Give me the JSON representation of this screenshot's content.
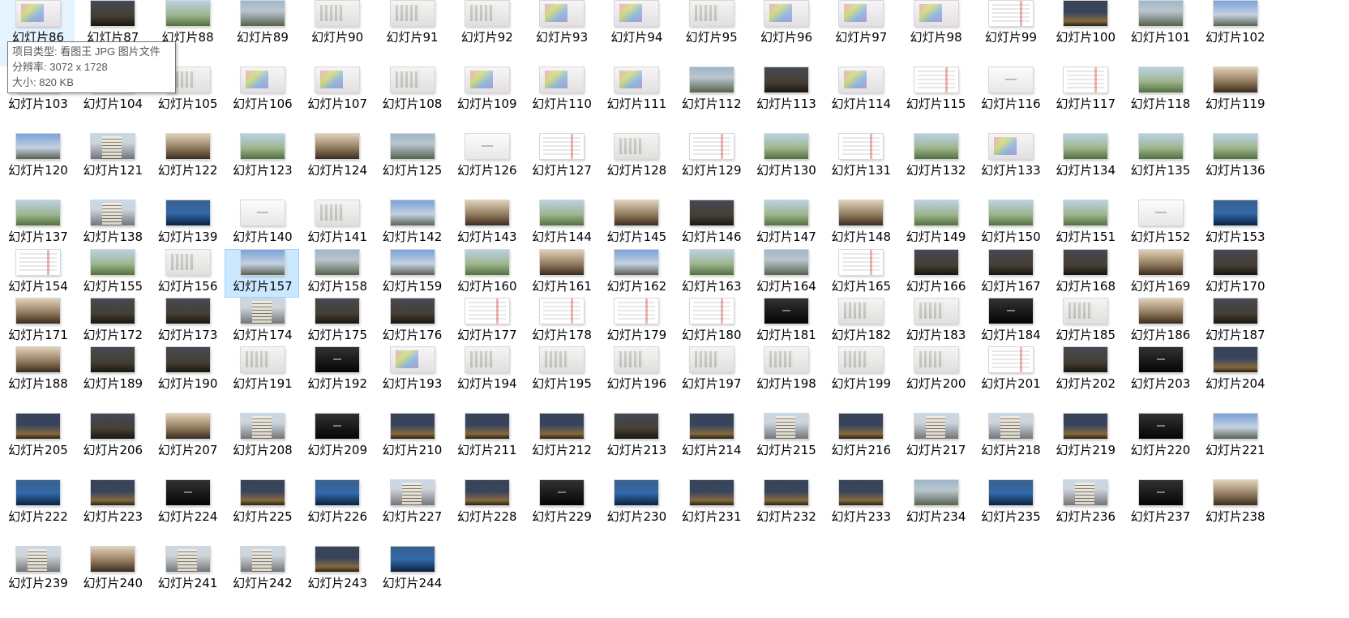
{
  "files": [
    {
      "label": "幻灯片86",
      "thumb": "color",
      "selected": false,
      "hovered": true
    },
    {
      "label": "幻灯片87",
      "thumb": "dark"
    },
    {
      "label": "幻灯片88",
      "thumb": "green"
    },
    {
      "label": "幻灯片89",
      "thumb": "photo"
    },
    {
      "label": "幻灯片90",
      "thumb": "plan"
    },
    {
      "label": "幻灯片91",
      "thumb": "plan"
    },
    {
      "label": "幻灯片92",
      "thumb": "plan"
    },
    {
      "label": "幻灯片93",
      "thumb": "color"
    },
    {
      "label": "幻灯片94",
      "thumb": "color"
    },
    {
      "label": "幻灯片95",
      "thumb": "plan"
    },
    {
      "label": "幻灯片96",
      "thumb": "color"
    },
    {
      "label": "幻灯片97",
      "thumb": "color"
    },
    {
      "label": "幻灯片98",
      "thumb": "color"
    },
    {
      "label": "幻灯片99",
      "thumb": "doc"
    },
    {
      "label": "幻灯片100",
      "thumb": "night"
    },
    {
      "label": "幻灯片101",
      "thumb": "photo"
    },
    {
      "label": "幻灯片102",
      "thumb": "sky"
    },
    {
      "label": "幻灯片103",
      "thumb": "plan"
    },
    {
      "label": "幻灯片104",
      "thumb": "plan"
    },
    {
      "label": "幻灯片105",
      "thumb": "plan"
    },
    {
      "label": "幻灯片106",
      "thumb": "color"
    },
    {
      "label": "幻灯片107",
      "thumb": "color"
    },
    {
      "label": "幻灯片108",
      "thumb": "plan"
    },
    {
      "label": "幻灯片109",
      "thumb": "color"
    },
    {
      "label": "幻灯片110",
      "thumb": "color"
    },
    {
      "label": "幻灯片111",
      "thumb": "color"
    },
    {
      "label": "幻灯片112",
      "thumb": "photo"
    },
    {
      "label": "幻灯片113",
      "thumb": "dark"
    },
    {
      "label": "幻灯片114",
      "thumb": "color"
    },
    {
      "label": "幻灯片115",
      "thumb": "doc"
    },
    {
      "label": "幻灯片116",
      "thumb": "white"
    },
    {
      "label": "幻灯片117",
      "thumb": "doc"
    },
    {
      "label": "幻灯片118",
      "thumb": "green"
    },
    {
      "label": "幻灯片119",
      "thumb": "interior"
    },
    {
      "label": "幻灯片120",
      "thumb": "sky"
    },
    {
      "label": "幻灯片121",
      "thumb": "bld"
    },
    {
      "label": "幻灯片122",
      "thumb": "interior"
    },
    {
      "label": "幻灯片123",
      "thumb": "green"
    },
    {
      "label": "幻灯片124",
      "thumb": "interior"
    },
    {
      "label": "幻灯片125",
      "thumb": "photo"
    },
    {
      "label": "幻灯片126",
      "thumb": "white"
    },
    {
      "label": "幻灯片127",
      "thumb": "doc"
    },
    {
      "label": "幻灯片128",
      "thumb": "plan"
    },
    {
      "label": "幻灯片129",
      "thumb": "doc"
    },
    {
      "label": "幻灯片130",
      "thumb": "green"
    },
    {
      "label": "幻灯片131",
      "thumb": "doc"
    },
    {
      "label": "幻灯片132",
      "thumb": "green"
    },
    {
      "label": "幻灯片133",
      "thumb": "color"
    },
    {
      "label": "幻灯片134",
      "thumb": "green"
    },
    {
      "label": "幻灯片135",
      "thumb": "green"
    },
    {
      "label": "幻灯片136",
      "thumb": "green"
    },
    {
      "label": "幻灯片137",
      "thumb": "green"
    },
    {
      "label": "幻灯片138",
      "thumb": "bld"
    },
    {
      "label": "幻灯片139",
      "thumb": "blue"
    },
    {
      "label": "幻灯片140",
      "thumb": "white"
    },
    {
      "label": "幻灯片141",
      "thumb": "plan"
    },
    {
      "label": "幻灯片142",
      "thumb": "sky"
    },
    {
      "label": "幻灯片143",
      "thumb": "interior"
    },
    {
      "label": "幻灯片144",
      "thumb": "green"
    },
    {
      "label": "幻灯片145",
      "thumb": "interior"
    },
    {
      "label": "幻灯片146",
      "thumb": "dark"
    },
    {
      "label": "幻灯片147",
      "thumb": "green"
    },
    {
      "label": "幻灯片148",
      "thumb": "interior"
    },
    {
      "label": "幻灯片149",
      "thumb": "green"
    },
    {
      "label": "幻灯片150",
      "thumb": "green"
    },
    {
      "label": "幻灯片151",
      "thumb": "green"
    },
    {
      "label": "幻灯片152",
      "thumb": "white"
    },
    {
      "label": "幻灯片153",
      "thumb": "blue"
    },
    {
      "label": "幻灯片154",
      "thumb": "doc"
    },
    {
      "label": "幻灯片155",
      "thumb": "green"
    },
    {
      "label": "幻灯片156",
      "thumb": "plan"
    },
    {
      "label": "幻灯片157",
      "thumb": "sky",
      "selected": true
    },
    {
      "label": "幻灯片158",
      "thumb": "photo"
    },
    {
      "label": "幻灯片159",
      "thumb": "sky"
    },
    {
      "label": "幻灯片160",
      "thumb": "green"
    },
    {
      "label": "幻灯片161",
      "thumb": "interior"
    },
    {
      "label": "幻灯片162",
      "thumb": "sky"
    },
    {
      "label": "幻灯片163",
      "thumb": "green"
    },
    {
      "label": "幻灯片164",
      "thumb": "photo"
    },
    {
      "label": "幻灯片165",
      "thumb": "doc"
    },
    {
      "label": "幻灯片166",
      "thumb": "dark"
    },
    {
      "label": "幻灯片167",
      "thumb": "dark"
    },
    {
      "label": "幻灯片168",
      "thumb": "dark"
    },
    {
      "label": "幻灯片169",
      "thumb": "interior"
    },
    {
      "label": "幻灯片170",
      "thumb": "dark"
    },
    {
      "label": "幻灯片171",
      "thumb": "interior"
    },
    {
      "label": "幻灯片172",
      "thumb": "dark"
    },
    {
      "label": "幻灯片173",
      "thumb": "dark"
    },
    {
      "label": "幻灯片174",
      "thumb": "bld"
    },
    {
      "label": "幻灯片175",
      "thumb": "dark"
    },
    {
      "label": "幻灯片176",
      "thumb": "dark"
    },
    {
      "label": "幻灯片177",
      "thumb": "doc"
    },
    {
      "label": "幻灯片178",
      "thumb": "doc"
    },
    {
      "label": "幻灯片179",
      "thumb": "doc"
    },
    {
      "label": "幻灯片180",
      "thumb": "doc"
    },
    {
      "label": "幻灯片181",
      "thumb": "black"
    },
    {
      "label": "幻灯片182",
      "thumb": "plan"
    },
    {
      "label": "幻灯片183",
      "thumb": "plan"
    },
    {
      "label": "幻灯片184",
      "thumb": "black"
    },
    {
      "label": "幻灯片185",
      "thumb": "plan"
    },
    {
      "label": "幻灯片186",
      "thumb": "interior"
    },
    {
      "label": "幻灯片187",
      "thumb": "dark"
    },
    {
      "label": "幻灯片188",
      "thumb": "interior"
    },
    {
      "label": "幻灯片189",
      "thumb": "dark"
    },
    {
      "label": "幻灯片190",
      "thumb": "dark"
    },
    {
      "label": "幻灯片191",
      "thumb": "plan"
    },
    {
      "label": "幻灯片192",
      "thumb": "black"
    },
    {
      "label": "幻灯片193",
      "thumb": "color"
    },
    {
      "label": "幻灯片194",
      "thumb": "plan"
    },
    {
      "label": "幻灯片195",
      "thumb": "plan"
    },
    {
      "label": "幻灯片196",
      "thumb": "plan"
    },
    {
      "label": "幻灯片197",
      "thumb": "plan"
    },
    {
      "label": "幻灯片198",
      "thumb": "plan"
    },
    {
      "label": "幻灯片199",
      "thumb": "plan"
    },
    {
      "label": "幻灯片200",
      "thumb": "plan"
    },
    {
      "label": "幻灯片201",
      "thumb": "doc"
    },
    {
      "label": "幻灯片202",
      "thumb": "dark"
    },
    {
      "label": "幻灯片203",
      "thumb": "black"
    },
    {
      "label": "幻灯片204",
      "thumb": "night"
    },
    {
      "label": "幻灯片205",
      "thumb": "night"
    },
    {
      "label": "幻灯片206",
      "thumb": "dark"
    },
    {
      "label": "幻灯片207",
      "thumb": "interior"
    },
    {
      "label": "幻灯片208",
      "thumb": "bld"
    },
    {
      "label": "幻灯片209",
      "thumb": "black"
    },
    {
      "label": "幻灯片210",
      "thumb": "night"
    },
    {
      "label": "幻灯片211",
      "thumb": "night"
    },
    {
      "label": "幻灯片212",
      "thumb": "night"
    },
    {
      "label": "幻灯片213",
      "thumb": "dark"
    },
    {
      "label": "幻灯片214",
      "thumb": "night"
    },
    {
      "label": "幻灯片215",
      "thumb": "bld"
    },
    {
      "label": "幻灯片216",
      "thumb": "night"
    },
    {
      "label": "幻灯片217",
      "thumb": "bld"
    },
    {
      "label": "幻灯片218",
      "thumb": "bld"
    },
    {
      "label": "幻灯片219",
      "thumb": "night"
    },
    {
      "label": "幻灯片220",
      "thumb": "black"
    },
    {
      "label": "幻灯片221",
      "thumb": "sky"
    },
    {
      "label": "幻灯片222",
      "thumb": "blue"
    },
    {
      "label": "幻灯片223",
      "thumb": "night"
    },
    {
      "label": "幻灯片224",
      "thumb": "black"
    },
    {
      "label": "幻灯片225",
      "thumb": "night"
    },
    {
      "label": "幻灯片226",
      "thumb": "blue"
    },
    {
      "label": "幻灯片227",
      "thumb": "bld"
    },
    {
      "label": "幻灯片228",
      "thumb": "night"
    },
    {
      "label": "幻灯片229",
      "thumb": "black"
    },
    {
      "label": "幻灯片230",
      "thumb": "blue"
    },
    {
      "label": "幻灯片231",
      "thumb": "night"
    },
    {
      "label": "幻灯片232",
      "thumb": "night"
    },
    {
      "label": "幻灯片233",
      "thumb": "night"
    },
    {
      "label": "幻灯片234",
      "thumb": "photo"
    },
    {
      "label": "幻灯片235",
      "thumb": "blue"
    },
    {
      "label": "幻灯片236",
      "thumb": "bld"
    },
    {
      "label": "幻灯片237",
      "thumb": "black"
    },
    {
      "label": "幻灯片238",
      "thumb": "interior"
    },
    {
      "label": "幻灯片239",
      "thumb": "bld"
    },
    {
      "label": "幻灯片240",
      "thumb": "interior"
    },
    {
      "label": "幻灯片241",
      "thumb": "bld"
    },
    {
      "label": "幻灯片242",
      "thumb": "bld"
    },
    {
      "label": "幻灯片243",
      "thumb": "night"
    },
    {
      "label": "幻灯片244",
      "thumb": "blue"
    }
  ],
  "tooltip": {
    "type_line": "项目类型: 看图王 JPG 图片文件",
    "resolution_line": "分辨率: 3072 x 1728",
    "size_line": "大小: 820 KB"
  }
}
